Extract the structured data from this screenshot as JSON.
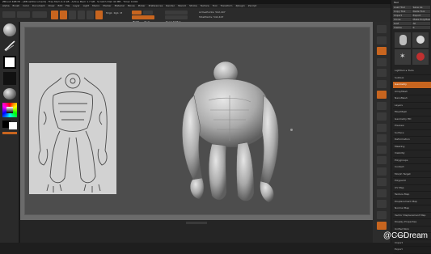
{
  "window": {
    "title": "ZBrush 4R8 P2 - [ZBrushDocument] - Free Mem 4.4 GB - Active Mem 1.7 GB - Scratch Disk 44 MB - Timer 0.002"
  },
  "menubar": {
    "items": [
      "Alpha",
      "Brush",
      "Color",
      "Document",
      "Draw",
      "Edit",
      "File",
      "Layer",
      "Light",
      "Macro",
      "Marker",
      "Material",
      "Movie",
      "Picker",
      "Preferences",
      "Render",
      "Stencil",
      "Stroke",
      "Texture",
      "Tool",
      "Transform",
      "Zplugin",
      "Zscript"
    ]
  },
  "toolbar": {
    "lightbox": "LightBox",
    "spotlight": "Spotlight",
    "live_boolean": "Live Boolean",
    "edit": "Edit",
    "draw": "Draw",
    "move": "Move",
    "scale": "Scale",
    "rotate": "Rotate",
    "mrgb": "Mrgb",
    "rgb": "Rgb",
    "m": "M",
    "zadd": "Zadd",
    "zsub": "Zsub",
    "focal_shift_label": "Focal Shift 0",
    "draw_size_label": "Draw Size 64",
    "z_intensity_label": "Z Intensity 25",
    "active_points": "ActivePoints: 542,407",
    "total_points": "TotalPoints: 542,407"
  },
  "statusbar": {
    "quicksave": "QuickSave",
    "see_through": "See-through 0",
    "menus": "Menus",
    "default_script": "DefaultZScript"
  },
  "panel": {
    "header": "Tool",
    "buttons": [
      "Load Tool",
      "Save As",
      "Copy Tool",
      "Paste Tool",
      "Import",
      "Export",
      "Clone",
      "Make PolyMesh3D",
      "GoZ",
      "All",
      "Visible",
      "R"
    ],
    "sections": [
      "Lightbox ▸ Tools",
      "Subtool",
      "Geometry",
      "ArrayMesh",
      "NanoMesh",
      "Layers",
      "FiberMesh",
      "Geometry HD",
      "Preview",
      "Surface",
      "Deformation",
      "Masking",
      "Visibility",
      "Polygroups",
      "Contact",
      "Morph Target",
      "Polypaint",
      "UV Map",
      "Texture Map",
      "Displacement Map",
      "Normal Map",
      "Vector Displacement Map",
      "Display Properties",
      "Unified Skin",
      "Initialize",
      "Import",
      "Export"
    ],
    "active_section": "Geometry"
  },
  "reference_image": {
    "description_label": ""
  },
  "watermark": "@CGDream",
  "colors": {
    "accent": "#c8651f",
    "viewport": "#4d4d4d",
    "frame": "#6b6b6b"
  }
}
